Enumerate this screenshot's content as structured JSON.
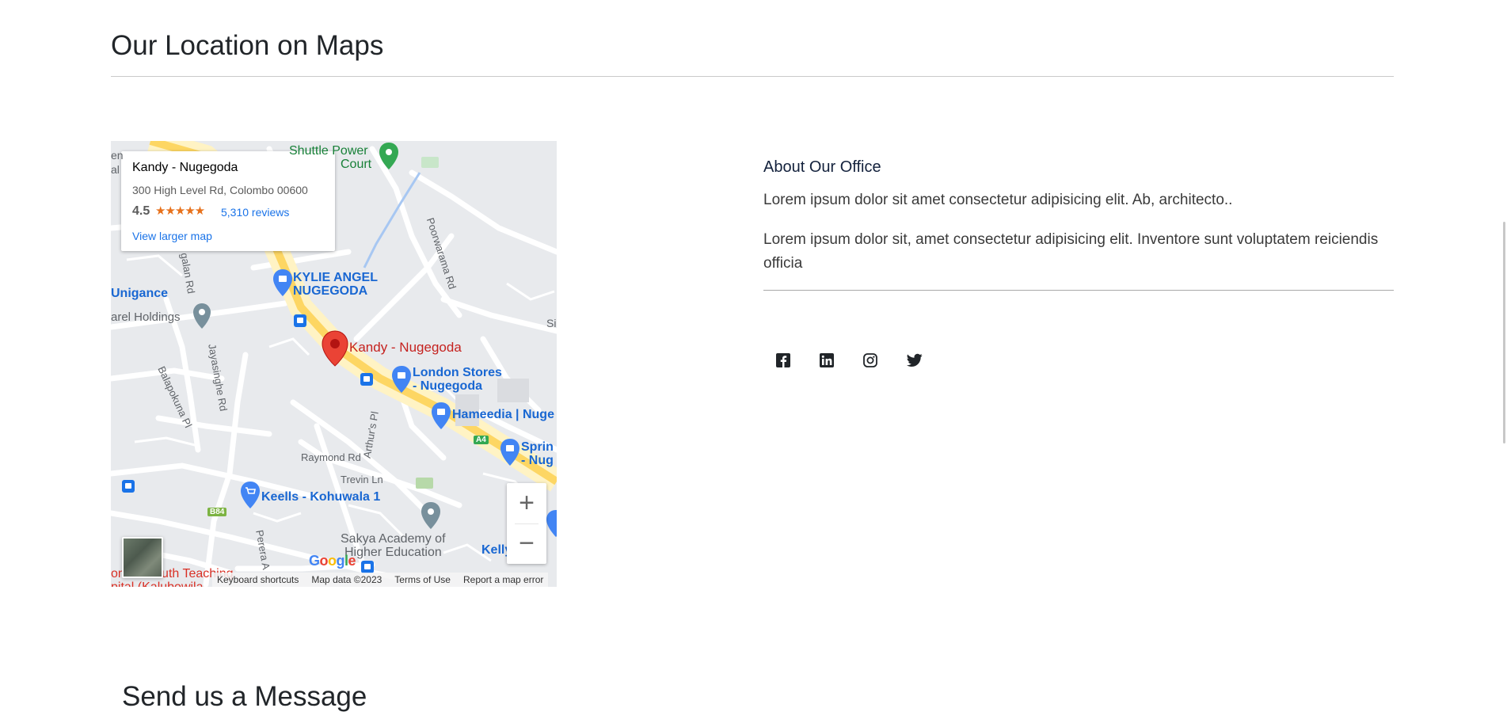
{
  "page": {
    "section_title": "Our Location on Maps",
    "send_title": "Send us a Message"
  },
  "map": {
    "place_card": {
      "name": "Kandy - Nugegoda",
      "address": "300 High Level Rd, Colombo 00600",
      "rating": "4.5",
      "stars": "★★★★★",
      "reviews": "5,310 reviews",
      "larger_map": "View larger map"
    },
    "labels": {
      "shuttle_power": "Shuttle Power",
      "court": "Court",
      "poorwarama_rd": "Poorwarama Rd",
      "en": "en",
      "al": "al",
      "galan_rd": "galan Rd",
      "kylie_angel": "KYLIE ANGEL",
      "nugegoda": "NUGEGODA",
      "unigance": "Unigance",
      "arel_holdings": "arel Holdings",
      "si": "Si",
      "marker_label": "Kandy - Nugegoda",
      "london_stores": "London Stores",
      "london_stores_2": "- Nugegoda",
      "balapokuna": "Balapokuna Pl",
      "jayasinghe": "Jayasinghe Rd",
      "arthurs": "Arthur's Pl",
      "hameedia": "Hameedia | Nuge",
      "a4": "A4",
      "spring": "Sprin",
      "spring_2": "- Nug",
      "raymond": "Raymond Rd",
      "trevin": "Trevin Ln",
      "keells": "Keells - Kohuwala 1",
      "b84": "B84",
      "sakya": "Sakya Academy of",
      "sakya_2": "Higher Education",
      "perera": "Perera A",
      "kelly": "Kelly",
      "teaching": "ombo South Teaching",
      "teaching_2": "pital (Kalubowila"
    },
    "zoom_in": "+",
    "zoom_out": "−",
    "google": [
      "G",
      "o",
      "o",
      "g",
      "l",
      "e"
    ],
    "google_colors": [
      "#4285f4",
      "#ea4335",
      "#fbbc05",
      "#4285f4",
      "#34a853",
      "#ea4335"
    ],
    "attribution": {
      "shortcuts": "Keyboard shortcuts",
      "map_data": "Map data ©2023",
      "terms": "Terms of Use",
      "report": "Report a map error"
    }
  },
  "about": {
    "title": "About Our Office",
    "p1": "Lorem ipsum dolor sit amet consectetur adipisicing elit. Ab, architecto..",
    "p2": "Lorem ipsum dolor sit, amet consectetur adipisicing elit. Inventore sunt voluptatem reiciendis officia"
  },
  "social": [
    {
      "icon": "facebook-icon"
    },
    {
      "icon": "linkedin-icon"
    },
    {
      "icon": "instagram-icon"
    },
    {
      "icon": "twitter-icon"
    }
  ],
  "colors": {
    "accent_blue": "#1a73e8",
    "star_orange": "#e7711b",
    "marker_red": "#ea4335",
    "road_yellow": "#fdd663"
  }
}
